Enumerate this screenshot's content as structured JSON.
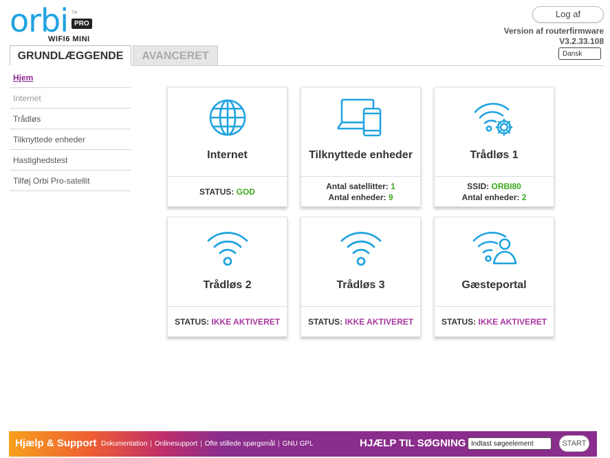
{
  "logo": {
    "wordmark": "orbi",
    "tm": "TM",
    "badge": "PRO",
    "subtitle": "WIFI6 MINI"
  },
  "header": {
    "logout_label": "Log af",
    "firmware_label": "Version af routerfirmware",
    "firmware_version": "V3.2.33.108",
    "language": "Dansk"
  },
  "tabs": [
    {
      "label": "GRUNDLÆGGENDE",
      "active": true
    },
    {
      "label": "AVANCERET",
      "active": false
    }
  ],
  "sidebar": {
    "items": [
      {
        "label": "Hjem",
        "state": "active"
      },
      {
        "label": "Internet",
        "state": "disabled"
      },
      {
        "label": "Trådløs",
        "state": "normal"
      },
      {
        "label": "Tilknyttede enheder",
        "state": "normal"
      },
      {
        "label": "Hastighedstest",
        "state": "normal"
      },
      {
        "label": "Tilføj Orbi Pro-satellit",
        "state": "normal"
      }
    ]
  },
  "cards": {
    "internet": {
      "icon": "globe-icon",
      "title": "Internet",
      "status_label": "STATUS:",
      "status_value": "GOD"
    },
    "devices": {
      "icon": "devices-icon",
      "title": "Tilknyttede enheder",
      "satellites_label": "Antal satellitter:",
      "satellites_value": "1",
      "devices_label": "Antal enheder:",
      "devices_value": "9"
    },
    "wireless1": {
      "icon": "wifi-settings-icon",
      "title": "Trådløs 1",
      "ssid_label": "SSID:",
      "ssid_value": "ORBI80",
      "devices_label": "Antal enheder:",
      "devices_value": "2"
    },
    "wireless2": {
      "icon": "wifi-icon",
      "title": "Trådløs 2",
      "status_label": "STATUS:",
      "status_value": "IKKE AKTIVERET"
    },
    "wireless3": {
      "icon": "wifi-icon",
      "title": "Trådløs 3",
      "status_label": "STATUS:",
      "status_value": "IKKE AKTIVERET"
    },
    "guest": {
      "icon": "wifi-user-icon",
      "title": "Gæsteportal",
      "status_label": "STATUS:",
      "status_value": "IKKE AKTIVERET"
    }
  },
  "footer": {
    "help_title": "Hjælp & Support",
    "links": [
      "Dokumentation",
      "Onlinesupport",
      "Ofte stillede spørgsmål",
      "GNU GPL"
    ],
    "search_label": "HJÆLP TIL SØGNING",
    "search_placeholder": "Indtast søgeelement",
    "start_label": "START"
  },
  "colors": {
    "accent_blue": "#1fa3e0",
    "status_green": "#3aa81c",
    "status_purple": "#a8379f",
    "footer_purple": "#8a2d8c"
  }
}
